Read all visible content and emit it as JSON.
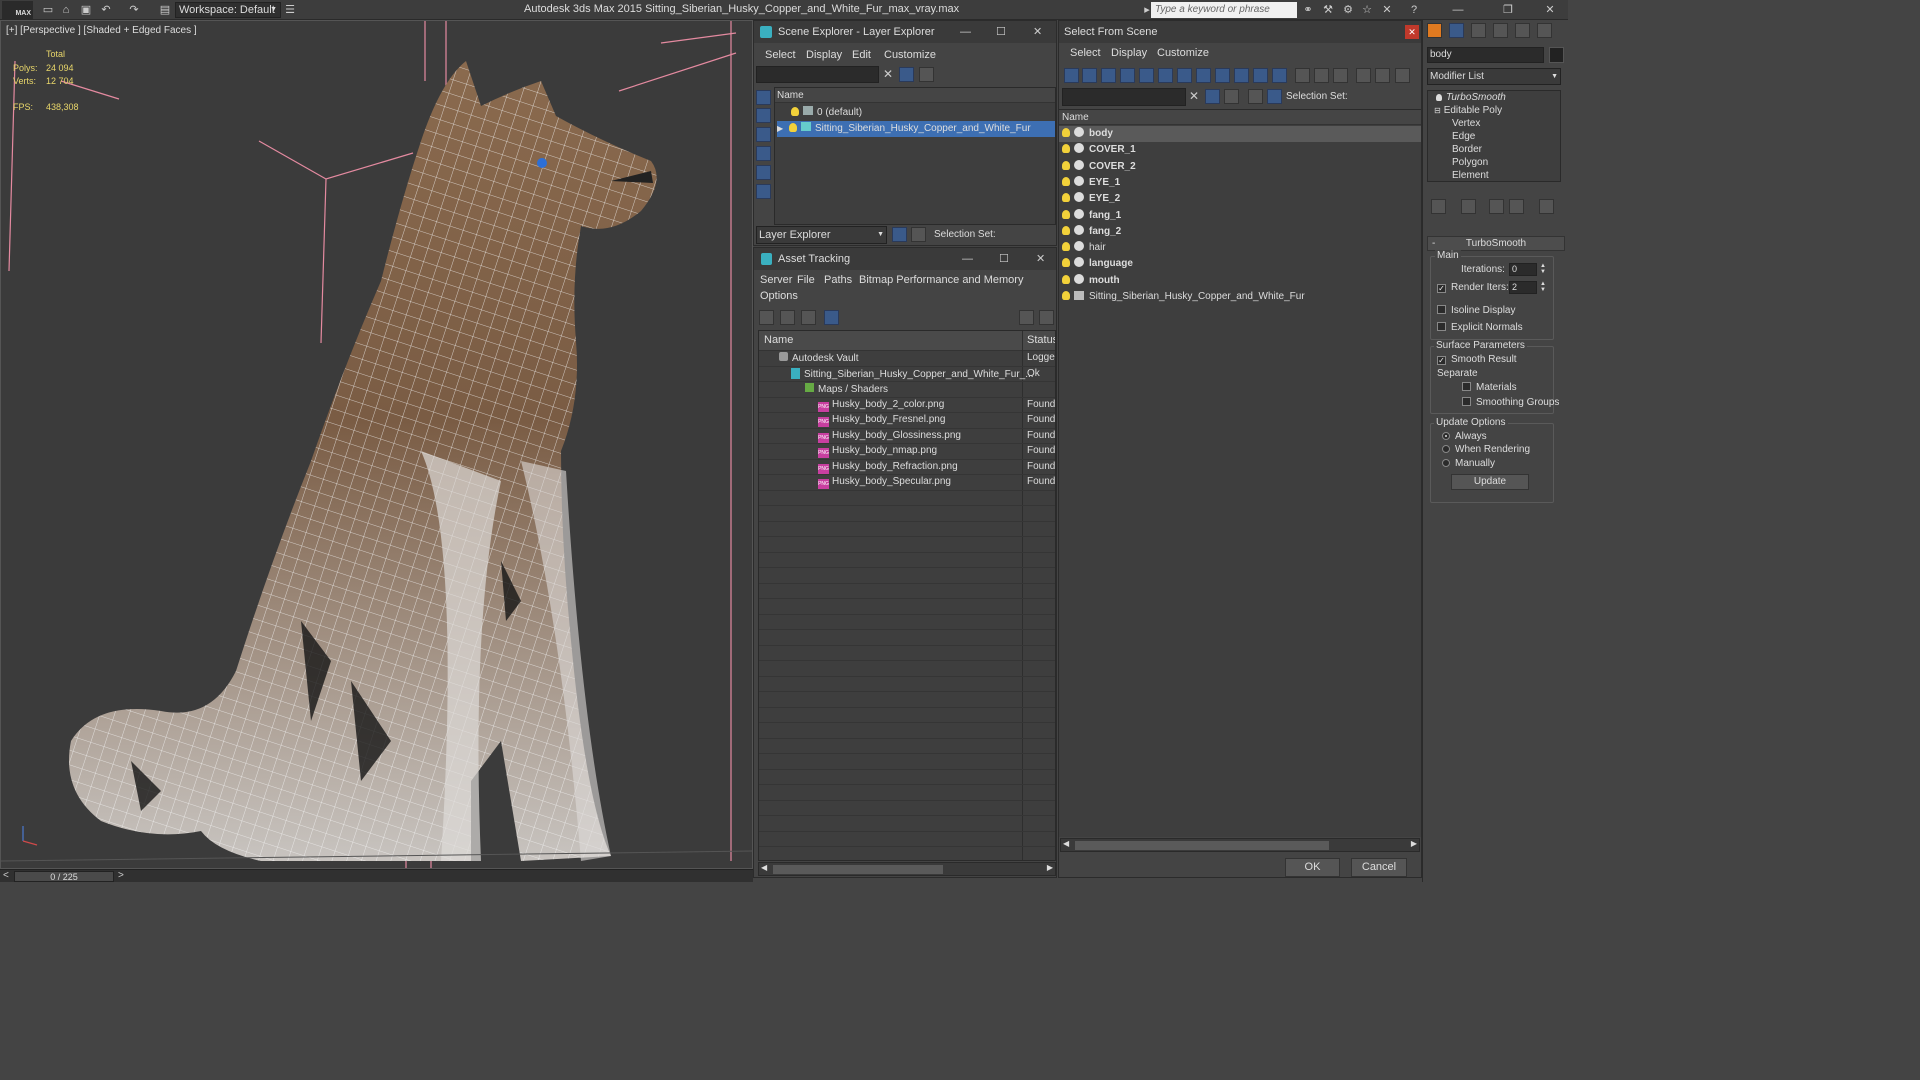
{
  "app": {
    "title": "Autodesk 3ds Max  2015     Sitting_Siberian_Husky_Copper_and_White_Fur_max_vray.max",
    "logo": "MAX",
    "workspace": "Workspace: Default",
    "search_placeholder": "Type a keyword or phrase"
  },
  "viewport": {
    "label": "[+] [Perspective ] [Shaded + Edged Faces ]",
    "stats_total": "Total",
    "polys_label": "Polys:",
    "polys": "24 094",
    "verts_label": "Verts:",
    "verts": "12 704",
    "fps_label": "FPS:",
    "fps": "438,308"
  },
  "timeline": {
    "frame": "0 / 225",
    "prev": "<",
    "next": ">"
  },
  "scene_explorer": {
    "title": "Scene Explorer - Layer Explorer",
    "menus": [
      "Select",
      "Display",
      "Edit",
      "Customize"
    ],
    "col_name": "Name",
    "rows": [
      "0 (default)",
      "Sitting_Siberian_Husky_Copper_and_White_Fur"
    ],
    "footer_combo": "Layer Explorer",
    "selection_set": "Selection Set:"
  },
  "asset_tracking": {
    "title": "Asset Tracking",
    "menus": [
      "Server",
      "File",
      "Paths",
      "Bitmap Performance and Memory"
    ],
    "menu2": "Options",
    "col_name": "Name",
    "col_status": "Status",
    "rows": [
      {
        "name": "Autodesk Vault",
        "status": "Logged"
      },
      {
        "name": "Sitting_Siberian_Husky_Copper_and_White_Fur_...",
        "status": "Ok"
      },
      {
        "name": "Maps / Shaders",
        "status": ""
      },
      {
        "name": "Husky_body_2_color.png",
        "status": "Found"
      },
      {
        "name": "Husky_body_Fresnel.png",
        "status": "Found"
      },
      {
        "name": "Husky_body_Glossiness.png",
        "status": "Found"
      },
      {
        "name": "Husky_body_nmap.png",
        "status": "Found"
      },
      {
        "name": "Husky_body_Refraction.png",
        "status": "Found"
      },
      {
        "name": "Husky_body_Specular.png",
        "status": "Found"
      }
    ]
  },
  "select_from_scene": {
    "title": "Select From Scene",
    "menus": [
      "Select",
      "Display",
      "Customize"
    ],
    "selection_set": "Selection Set:",
    "col_name": "Name",
    "items": [
      "body",
      "COVER_1",
      "COVER_2",
      "EYE_1",
      "EYE_2",
      "fang_1",
      "fang_2",
      "hair",
      "language",
      "mouth",
      "Sitting_Siberian_Husky_Copper_and_White_Fur"
    ],
    "ok": "OK",
    "cancel": "Cancel"
  },
  "modify_panel": {
    "object_name": "body",
    "modifier_list": "Modifier List",
    "stack": [
      "TurboSmooth",
      "Editable Poly",
      "Vertex",
      "Edge",
      "Border",
      "Polygon",
      "Element"
    ],
    "rollout_title": "TurboSmooth",
    "main": "Main",
    "iterations_label": "Iterations:",
    "iterations": "0",
    "render_iters_label": "Render Iters:",
    "render_iters": "2",
    "isoline": "Isoline Display",
    "explicit_normals": "Explicit Normals",
    "surface_params": "Surface Parameters",
    "smooth_result": "Smooth Result",
    "separate": "Separate",
    "materials": "Materials",
    "smoothing_groups": "Smoothing Groups",
    "update_options": "Update Options",
    "always": "Always",
    "when_rendering": "When Rendering",
    "manually": "Manually",
    "update": "Update"
  },
  "colors": {
    "accent": "#3a6fb0",
    "highlight_row": "#3d6fb3",
    "bulb": "#f2d13a",
    "stats": "#e8d66a"
  }
}
